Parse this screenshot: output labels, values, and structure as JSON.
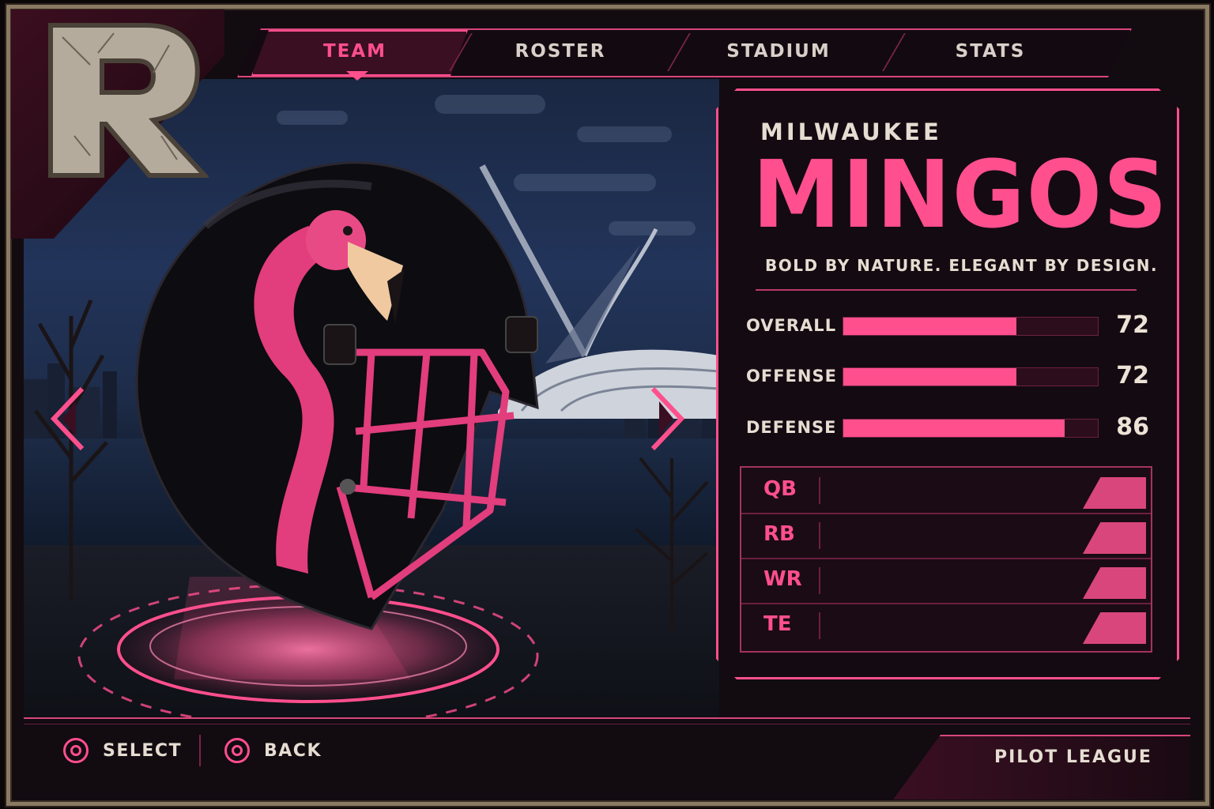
{
  "nav": {
    "tabs": [
      {
        "label": "TEAM",
        "active": true
      },
      {
        "label": "ROSTER",
        "active": false
      },
      {
        "label": "STADIUM",
        "active": false
      },
      {
        "label": "STATS",
        "active": false
      }
    ]
  },
  "logo": {
    "letter": "R"
  },
  "team": {
    "city": "MILWAUKEE",
    "name": "MINGOS",
    "slogan": "BOLD BY NATURE. ELEGANT BY DESIGN."
  },
  "ratings": [
    {
      "label": "OVERALL",
      "value": "72",
      "fill": 0.68
    },
    {
      "label": "OFFENSE",
      "value": "72",
      "fill": 0.68
    },
    {
      "label": "DEFENSE",
      "value": "86",
      "fill": 0.87
    }
  ],
  "positions": [
    "QB",
    "RB",
    "WR",
    "TE"
  ],
  "footer": {
    "select_label": "SELECT",
    "back_label": "BACK",
    "league": "PILOT LEAGUE"
  },
  "colors": {
    "accent": "#ff4f8d",
    "panel": "#140a11",
    "frame": "#8a7a63",
    "text": "#e6ddd2"
  },
  "icons": {
    "prev": "chevron-left-icon",
    "next": "chevron-right-icon",
    "select": "circle-button-icon",
    "back": "circle-button-icon"
  }
}
